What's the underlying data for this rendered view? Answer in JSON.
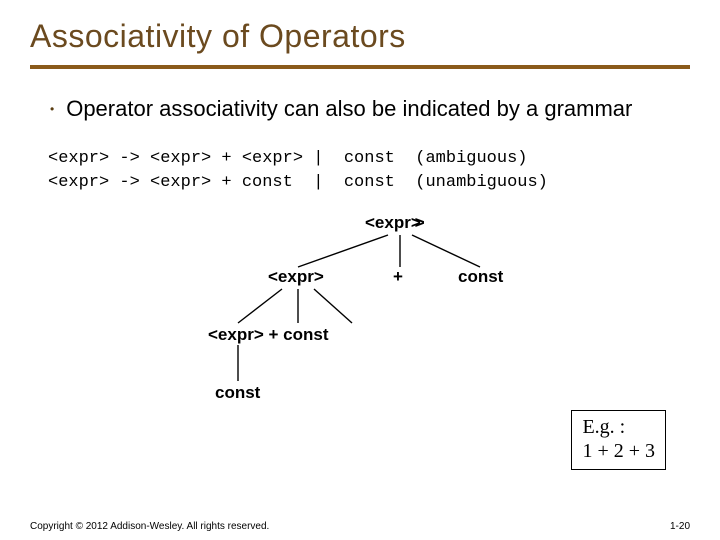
{
  "title": "Associativity of Operators",
  "bullet": "Operator associativity can also be indicated by a grammar",
  "code": {
    "line1": "<expr> -> <expr> + <expr> |  const  (ambiguous)",
    "line2": "<expr> -> <expr> + const  |  const  (unambiguous)"
  },
  "diagram": {
    "n_root": "<expr>",
    "n_glyph": ">",
    "n_l1_expr": "<expr>",
    "n_l1_plus": "+",
    "n_l1_const": "const",
    "n_l2_row": "<expr> +  const",
    "n_l3_const": "const"
  },
  "example": {
    "label": "E.g. :",
    "expr": "1 + 2 + 3"
  },
  "footer": {
    "copyright": "Copyright © 2012 Addison-Wesley. All rights reserved.",
    "pagenum": "1-20"
  }
}
